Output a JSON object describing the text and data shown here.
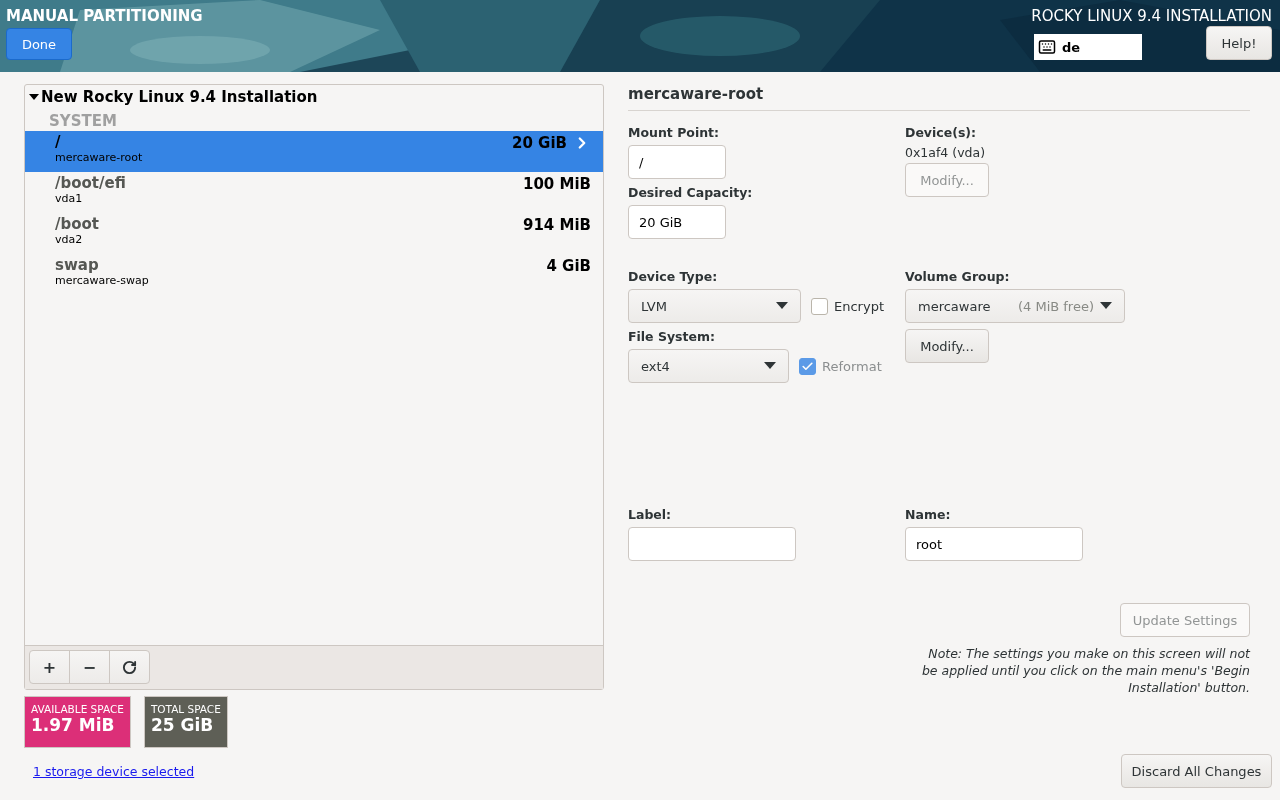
{
  "header": {
    "title": "MANUAL PARTITIONING",
    "done_button": "Done",
    "product": "ROCKY LINUX 9.4 INSTALLATION",
    "keyboard_layout": "de",
    "help_button": "Help!"
  },
  "partitions": {
    "title": "New Rocky Linux 9.4 Installation",
    "expanded": true,
    "section": "SYSTEM",
    "items": [
      {
        "mount": "/",
        "device": "mercaware-root",
        "size": "20 GiB",
        "selected": true
      },
      {
        "mount": "/boot/efi",
        "device": "vda1",
        "size": "100 MiB",
        "selected": false
      },
      {
        "mount": "/boot",
        "device": "vda2",
        "size": "914 MiB",
        "selected": false
      },
      {
        "mount": "swap",
        "device": "mercaware-swap",
        "size": "4 GiB",
        "selected": false
      }
    ]
  },
  "toolbar": {
    "add_button": "+",
    "remove_button": "−"
  },
  "space": [
    {
      "label": "AVAILABLE SPACE",
      "value": "1.97 MiB",
      "color": "#dc2f78"
    },
    {
      "label": "TOTAL SPACE",
      "value": "25 GiB",
      "color": "#5e5f56"
    }
  ],
  "storage_link": "1 storage device selected",
  "details": {
    "title": "mercaware-root",
    "mount_point": {
      "label": "Mount Point:",
      "value": "/"
    },
    "desired_capacity": {
      "label": "Desired Capacity:",
      "value": "20 GiB"
    },
    "devices": {
      "label": "Device(s):",
      "value": "0x1af4 (vda)",
      "modify": {
        "text": "Modify...",
        "disabled": true
      }
    },
    "device_type": {
      "label": "Device Type:",
      "value": "LVM"
    },
    "encrypt": {
      "label": "Encrypt",
      "checked": false,
      "disabled": false
    },
    "file_system": {
      "label": "File System:",
      "value": "ext4"
    },
    "reformat": {
      "label": "Reformat",
      "checked": true,
      "disabled": true
    },
    "volume_group": {
      "label": "Volume Group:",
      "value": "mercaware",
      "free": "(4 MiB free)",
      "modify": {
        "text": "Modify...",
        "disabled": false
      }
    },
    "label_field": {
      "label": "Label:"
    },
    "name_field": {
      "label": "Name:",
      "value": "root"
    },
    "update_button": {
      "text": "Update Settings",
      "disabled": true
    },
    "note": "Note:  The settings you make on this screen will not be applied until you click on the main menu's 'Begin Installation' button."
  },
  "discard_button": "Discard All Changes"
}
